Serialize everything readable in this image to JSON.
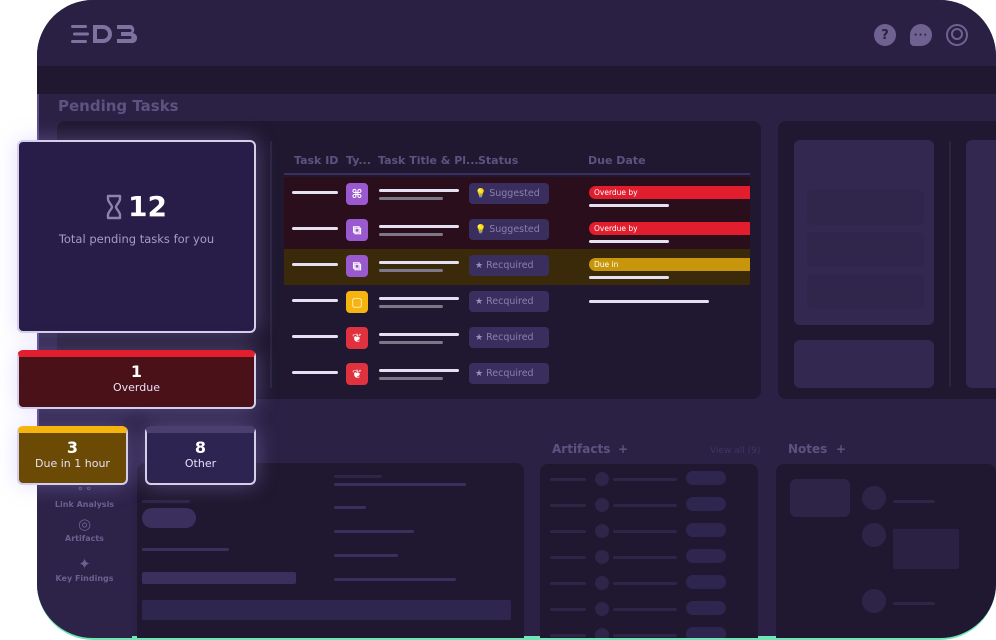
{
  "header": {
    "logo_text": "D3",
    "icons": [
      "help-icon",
      "chat-icon",
      "user-avatar-icon"
    ]
  },
  "page": {
    "title": "Pending Tasks"
  },
  "summary": {
    "total": {
      "count": "12",
      "label": "Total pending tasks for you",
      "icon": "hourglass-icon"
    },
    "overdue": {
      "count": "1",
      "label": "Overdue",
      "color": "#e11d2e"
    },
    "due_soon": {
      "count": "3",
      "label": "Due in 1 hour",
      "color": "#f6b40e"
    },
    "other": {
      "count": "8",
      "label": "Other"
    }
  },
  "table": {
    "columns": [
      "Task ID",
      "Ty...",
      "Task Title & Pl...",
      "Status",
      "Due Date"
    ],
    "rows": [
      {
        "type_icon": "⌘",
        "type_name": "command-icon",
        "type_color": "#9b59d0",
        "status": "Suggested",
        "status_icon": "💡",
        "due_label": "Overdue by",
        "row_state": "overdue"
      },
      {
        "type_icon": "⧉",
        "type_name": "plugin-icon",
        "type_color": "#9b59d0",
        "status": "Suggested",
        "status_icon": "💡",
        "due_label": "Overdue by",
        "row_state": "overdue"
      },
      {
        "type_icon": "⧉",
        "type_name": "plugin-icon",
        "type_color": "#9b59d0",
        "status": "Recquired",
        "status_icon": "★",
        "due_label": "Due in",
        "row_state": "due"
      },
      {
        "type_icon": "▢",
        "type_name": "clipboard-icon",
        "type_color": "#f6b40e",
        "status": "Recquired",
        "status_icon": "★",
        "due_label": "",
        "row_state": "normal"
      },
      {
        "type_icon": "❦",
        "type_name": "brain-icon",
        "type_color": "#e0313f",
        "status": "Recquired",
        "status_icon": "★",
        "due_label": "",
        "row_state": "normal"
      },
      {
        "type_icon": "❦",
        "type_name": "brain-icon",
        "type_color": "#e0313f",
        "status": "Recquired",
        "status_icon": "★",
        "due_label": "",
        "row_state": "normal"
      }
    ]
  },
  "nav": {
    "items": [
      {
        "label": "Link Analysis",
        "icon": "link-analysis-icon"
      },
      {
        "label": "Artifacts",
        "icon": "fingerprint-icon"
      },
      {
        "label": "Key Findings",
        "icon": "sparkle-icon"
      }
    ]
  },
  "artifacts": {
    "title": "Artifacts",
    "add": "+",
    "view_all": "View all (9)"
  },
  "notes": {
    "title": "Notes",
    "add": "+"
  },
  "colors": {
    "background": "#2b2145",
    "panel": "#1f1830",
    "accent_green": "#6ee7b7",
    "overdue": "#e11d2e",
    "due": "#c8960b"
  }
}
